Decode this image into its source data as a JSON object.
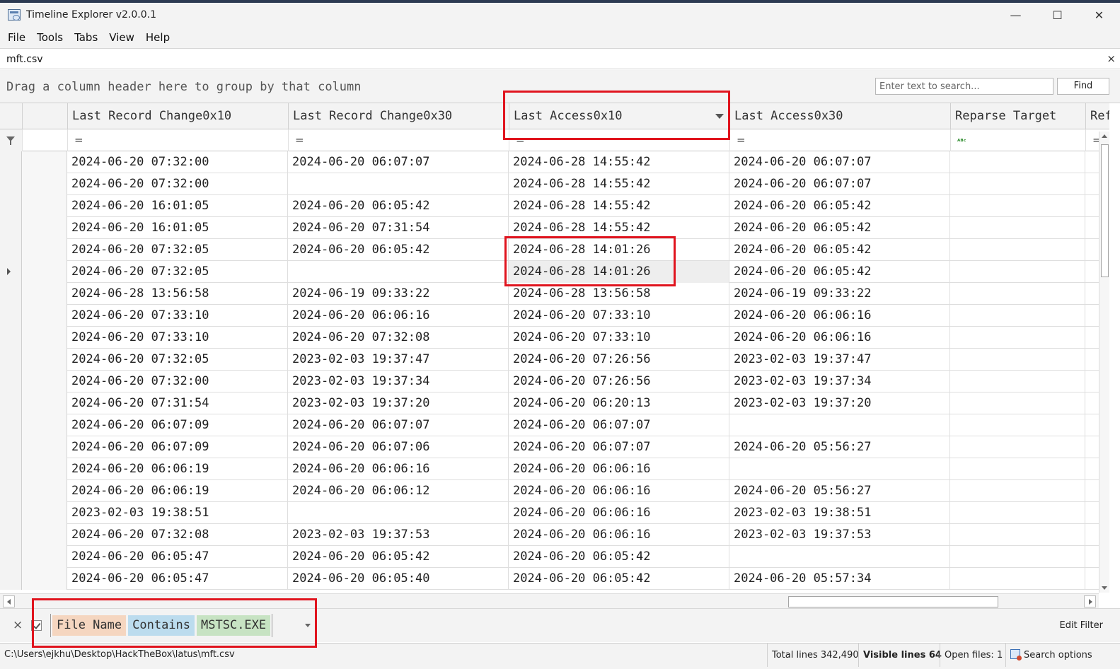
{
  "window": {
    "title": "Timeline Explorer v2.0.0.1",
    "minimize": "—",
    "maximize": "☐",
    "close": "✕"
  },
  "menu": [
    "File",
    "Tools",
    "Tabs",
    "View",
    "Help"
  ],
  "tab": {
    "label": "mft.csv",
    "close": "×"
  },
  "grouping": {
    "hint": "Drag a column header here to group by that column",
    "search_placeholder": "Enter text to search...",
    "find_label": "Find"
  },
  "columns": [
    "Last Record Change0x10",
    "Last Record Change0x30",
    "Last Access0x10",
    "Last Access0x30",
    "Reparse Target",
    "Ref"
  ],
  "filter_ops": [
    "=",
    "=",
    "=",
    "=",
    "ᴬᴮᶜ",
    "="
  ],
  "rows": [
    [
      "2024-06-20 07:32:00",
      "2024-06-20 06:07:07",
      "2024-06-28 14:55:42",
      "2024-06-20 06:07:07"
    ],
    [
      "2024-06-20 07:32:00",
      "",
      "2024-06-28 14:55:42",
      "2024-06-20 06:07:07"
    ],
    [
      "2024-06-20 16:01:05",
      "2024-06-20 06:05:42",
      "2024-06-28 14:55:42",
      "2024-06-20 06:05:42"
    ],
    [
      "2024-06-20 16:01:05",
      "2024-06-20 07:31:54",
      "2024-06-28 14:55:42",
      "2024-06-20 06:05:42"
    ],
    [
      "2024-06-20 07:32:05",
      "2024-06-20 06:05:42",
      "2024-06-28 14:01:26",
      "2024-06-20 06:05:42"
    ],
    [
      "2024-06-20 07:32:05",
      "",
      "2024-06-28 14:01:26",
      "2024-06-20 06:05:42"
    ],
    [
      "2024-06-28 13:56:58",
      "2024-06-19 09:33:22",
      "2024-06-28 13:56:58",
      "2024-06-19 09:33:22"
    ],
    [
      "2024-06-20 07:33:10",
      "2024-06-20 06:06:16",
      "2024-06-20 07:33:10",
      "2024-06-20 06:06:16"
    ],
    [
      "2024-06-20 07:33:10",
      "2024-06-20 07:32:08",
      "2024-06-20 07:33:10",
      "2024-06-20 06:06:16"
    ],
    [
      "2024-06-20 07:32:05",
      "2023-02-03 19:37:47",
      "2024-06-20 07:26:56",
      "2023-02-03 19:37:47"
    ],
    [
      "2024-06-20 07:32:00",
      "2023-02-03 19:37:34",
      "2024-06-20 07:26:56",
      "2023-02-03 19:37:34"
    ],
    [
      "2024-06-20 07:31:54",
      "2023-02-03 19:37:20",
      "2024-06-20 06:20:13",
      "2023-02-03 19:37:20"
    ],
    [
      "2024-06-20 06:07:09",
      "2024-06-20 06:07:07",
      "2024-06-20 06:07:07",
      ""
    ],
    [
      "2024-06-20 06:07:09",
      "2024-06-20 06:07:06",
      "2024-06-20 06:07:07",
      "2024-06-20 05:56:27"
    ],
    [
      "2024-06-20 06:06:19",
      "2024-06-20 06:06:16",
      "2024-06-20 06:06:16",
      ""
    ],
    [
      "2024-06-20 06:06:19",
      "2024-06-20 06:06:12",
      "2024-06-20 06:06:16",
      "2024-06-20 05:56:27"
    ],
    [
      "2023-02-03 19:38:51",
      "",
      "2024-06-20 06:06:16",
      "2023-02-03 19:38:51"
    ],
    [
      "2024-06-20 07:32:08",
      "2023-02-03 19:37:53",
      "2024-06-20 06:06:16",
      "2023-02-03 19:37:53"
    ],
    [
      "2024-06-20 06:05:47",
      "2024-06-20 06:05:42",
      "2024-06-20 06:05:42",
      ""
    ],
    [
      "2024-06-20 06:05:47",
      "2024-06-20 06:05:40",
      "2024-06-20 06:05:42",
      "2024-06-20 05:57:34"
    ]
  ],
  "filter_bar": {
    "close": "×",
    "field": "File Name",
    "operator": "Contains",
    "value": "MSTSC.EXE",
    "edit_label": "Edit Filter"
  },
  "status": {
    "path": "C:\\Users\\ejkhu\\Desktop\\HackTheBox\\latus\\mft.csv",
    "total_lines": "Total lines 342,490",
    "visible_lines": "Visible lines 64",
    "open_files": "Open files: 1",
    "search_options": "Search options"
  },
  "colors": {
    "highlight": "#e0141e",
    "token_field": "#f5d6c0",
    "token_operator": "#bcdcee",
    "token_value": "#c7e3c3"
  }
}
